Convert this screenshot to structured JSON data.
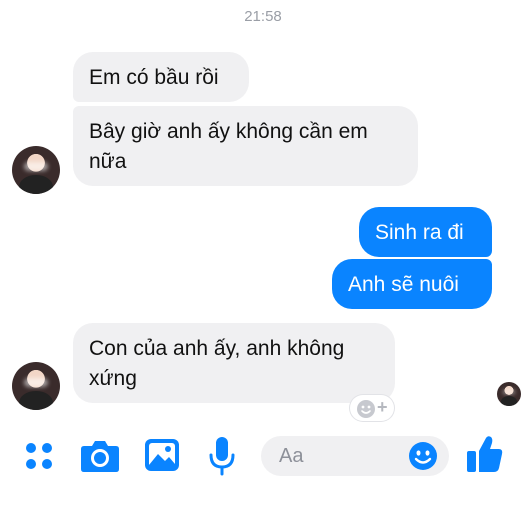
{
  "header": {
    "time": "21:58"
  },
  "messages": [
    {
      "text": "Em có bầu rồi",
      "sender": "them"
    },
    {
      "text": "Bây giờ anh ấy không cần em nữa",
      "sender": "them"
    },
    {
      "text": "Sinh ra đi",
      "sender": "me"
    },
    {
      "text": "Anh sẽ nuôi",
      "sender": "me"
    },
    {
      "text": "Con của anh ấy, anh không xứng",
      "sender": "them"
    }
  ],
  "composer": {
    "placeholder": "Aa"
  },
  "icons": {
    "apps": "apps-icon",
    "camera": "camera-icon",
    "gallery": "gallery-icon",
    "mic": "mic-icon",
    "emoji": "emoji-icon",
    "like": "like-icon",
    "reaction": "add-reaction-icon"
  },
  "colors": {
    "accent": "#0a84ff",
    "incoming_bubble": "#f0f0f2",
    "timestamp": "#9a9ea6"
  }
}
